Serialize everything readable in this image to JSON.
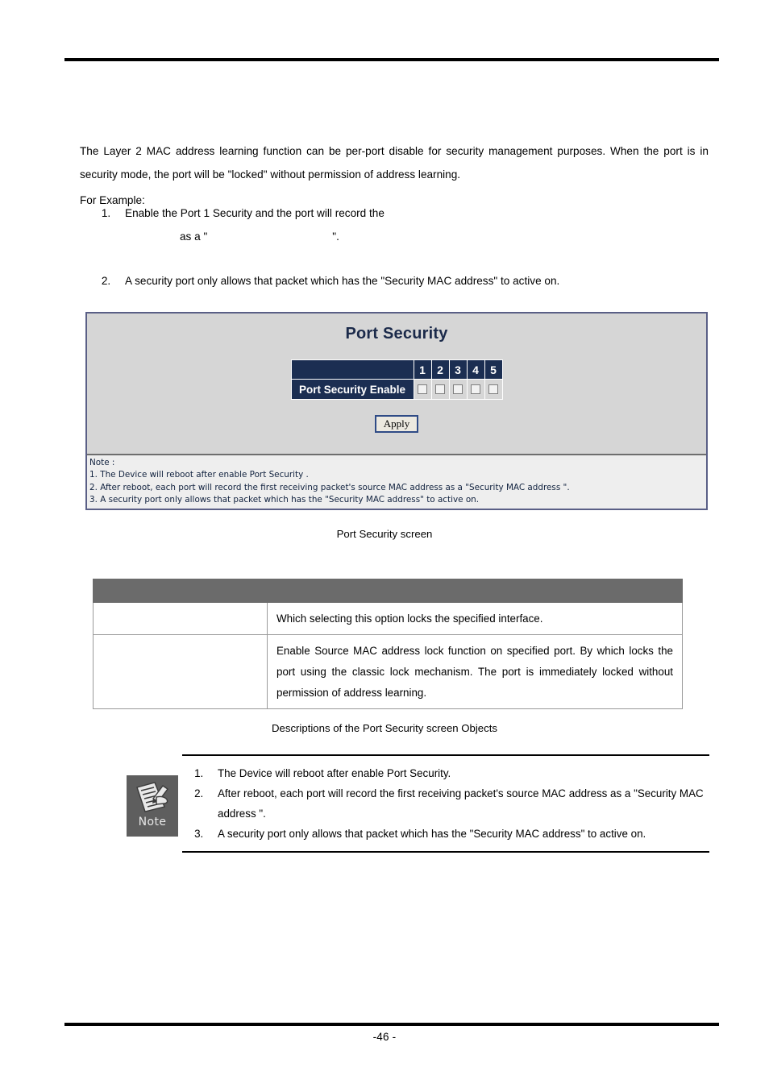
{
  "page": {
    "number_label": "-46 -"
  },
  "body": {
    "intro": "The Layer 2 MAC address learning function can be per-port disable for security management purposes. When the port is in security mode, the port will be \"locked\" without permission of address learning.",
    "for_example_label": "For Example:",
    "example_items": [
      {
        "line1": "Enable the Port 1 Security and the port will record the",
        "line2_prefix": "as a \"",
        "line2_suffix": "\"."
      },
      {
        "line1": "A security port only allows that packet which has the \"Security MAC address\" to active on."
      }
    ]
  },
  "screen": {
    "title": "Port Security",
    "table": {
      "corner_label": "",
      "port_headers": [
        "1",
        "2",
        "3",
        "4",
        "5"
      ],
      "row_label": "Port Security Enable",
      "checkbox_states": [
        false,
        false,
        false,
        false,
        false
      ]
    },
    "apply_label": "Apply",
    "note_lines": [
      "Note :",
      "1. The Device will reboot after enable Port Security .",
      "2. After reboot, each port will record the first receiving packet's source MAC address as a \"Security MAC address \".",
      "3. A security port only allows that packet which has the \"Security MAC address\" to active on."
    ]
  },
  "captions": {
    "screen": "Port Security screen",
    "table": "Descriptions of the Port Security screen Objects"
  },
  "desc_table": {
    "headers": [
      "",
      ""
    ],
    "rows": [
      {
        "object": "",
        "description": "Which selecting this option locks the specified interface."
      },
      {
        "object": "",
        "description": "Enable Source MAC address lock function on specified port. By which locks the port using the classic lock mechanism. The port is immediately locked without permission of address learning."
      }
    ]
  },
  "note_callout": {
    "icon_label": "Note",
    "items": [
      "The Device will reboot after enable Port Security.",
      "After reboot, each port will record the first receiving packet's source MAC address as a \"Security MAC address \".",
      "A security port only allows that packet which has the \"Security MAC address\" to active on."
    ]
  },
  "colors": {
    "screen_header_navy": "#1b2e52",
    "screen_bg": "#d6d6d6",
    "screen_note_bg": "#eeeeee",
    "desc_header_gray": "#6b6b6b",
    "note_icon_gray": "#5e5e5e",
    "apply_border_blue": "#2f4b86"
  }
}
